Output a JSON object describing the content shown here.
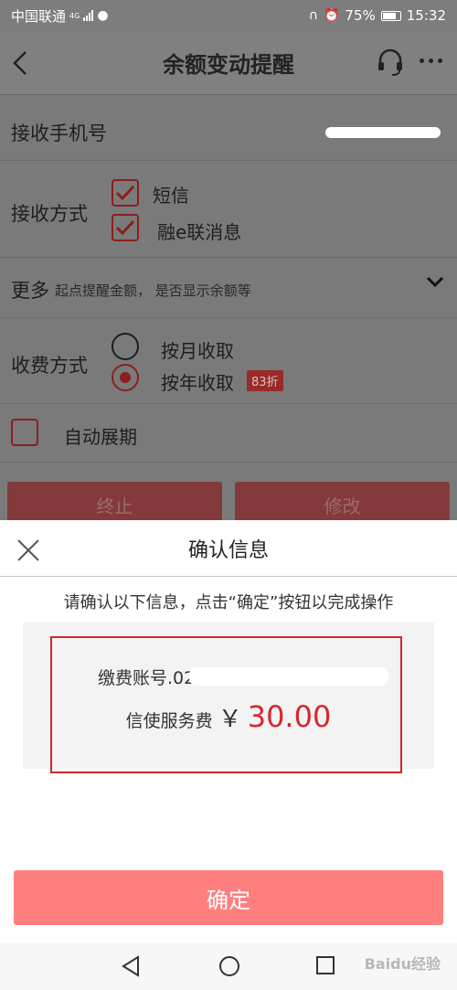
{
  "status_bar": {
    "carrier": "中国联通",
    "net": "4G",
    "battery": "75%",
    "time": "15:32"
  },
  "nav": {
    "title": "余额变动提醒",
    "back_icon": "chevron-left-icon",
    "service_icon": "headset-icon",
    "more_icon": "more-dots-icon"
  },
  "form": {
    "phone_label": "接收手机号",
    "method_label": "接收方式",
    "methods": [
      {
        "label": "短信",
        "checked": true
      },
      {
        "label": "融e联消息",
        "checked": true
      }
    ],
    "more_label": "更多",
    "more_hint": "起点提醒金额， 是否显示余额等",
    "fee_mode_label": "收费方式",
    "fee_modes": [
      {
        "label": "按月收取",
        "selected": false
      },
      {
        "label": "按年收取",
        "selected": true,
        "badge": "83折"
      }
    ],
    "auto_renew_label": "自动展期",
    "auto_renew_checked": false,
    "stop_button": "终止",
    "modify_button": "修改"
  },
  "dialog": {
    "title": "确认信息",
    "instruction": "请确认以下信息，点击“确定”按钮以完成操作",
    "account_label": "缴费账号",
    "account_value": ".0215",
    "fee_label": "信使服务费",
    "currency": "￥",
    "fee_amount": "30.00",
    "confirm_button": "确定"
  },
  "watermark": "Baidu经验",
  "colors": {
    "accent_red": "#d8272c",
    "confirm_bg": "#ff7f7f",
    "overlay_gray": "#7a7a7a"
  }
}
